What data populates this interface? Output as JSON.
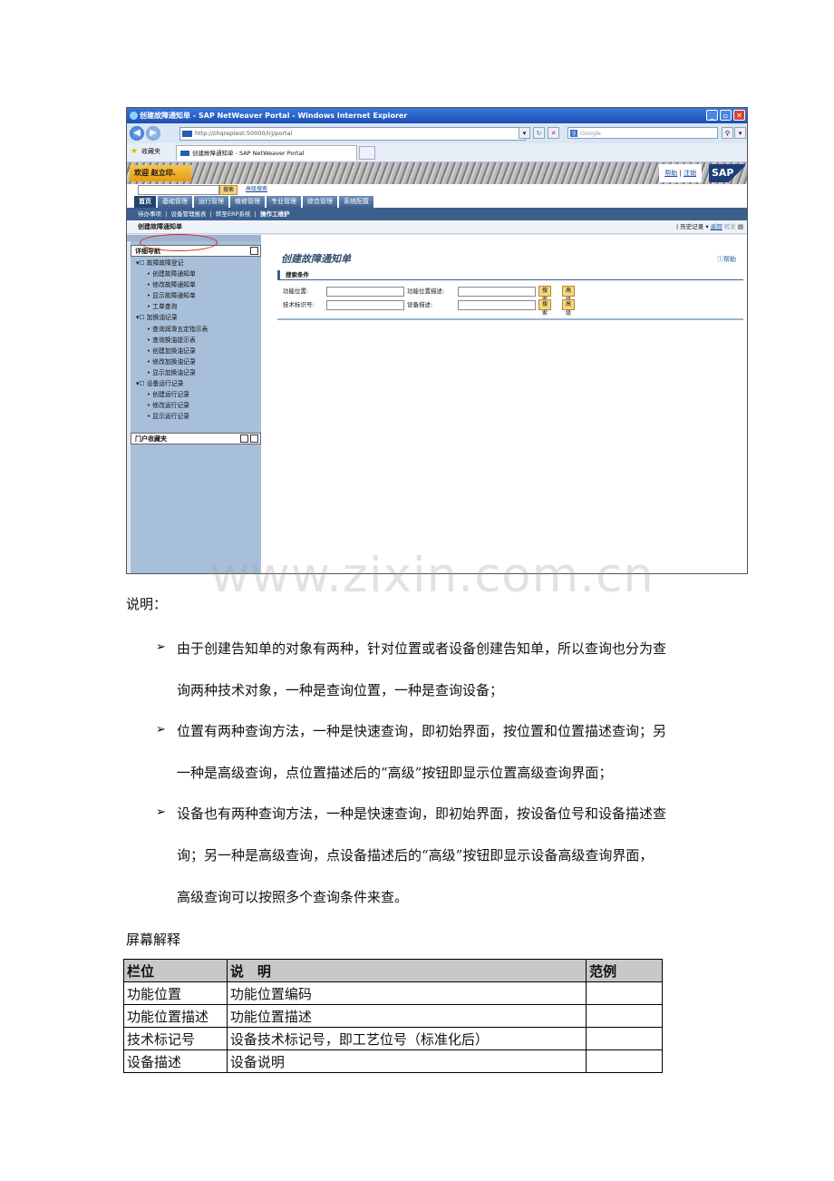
{
  "browser": {
    "title": "创建故障通知单 - SAP NetWeaver Portal - Windows Internet Explorer",
    "address": "http://zhqreptest:50000/irj/portal",
    "search_placeholder": "Google",
    "favorites_label": "收藏夹",
    "tab_title": "创建故障通知单 - SAP NetWeaver Portal"
  },
  "portal": {
    "welcome": "欢迎 赵立印.",
    "help_link": "帮助",
    "logout_link": "注销",
    "logo": "SAP",
    "search_button": "搜索",
    "advanced_search": "高级搜索",
    "top_tabs": [
      "首页",
      "基础管理",
      "运行管理",
      "维修管理",
      "专业管理",
      "综合管理",
      "系统配置"
    ],
    "sub_nav": [
      "待办事项",
      "设备管理报表",
      "转至ERP系统",
      "操作工维护"
    ],
    "page_header": "创建故障通知单",
    "history": "历史记录",
    "back": "返回",
    "forward": "转发",
    "detail_nav_title": "详细导航",
    "nav_groups": [
      {
        "label": "▾☐ 故障故障登记",
        "items": [
          "创建故障通知单",
          "修改故障通知单",
          "显示故障通知单",
          "工单查询"
        ]
      },
      {
        "label": "▾☐ 加换油记录",
        "items": [
          "查询润滑五定指示表",
          "查询换油提示表",
          "创建加换油记录",
          "修改加换油记录",
          "显示加换油记录"
        ]
      },
      {
        "label": "▾☐ 设备运行记录",
        "items": [
          "创建运行记录",
          "修改运行记录",
          "显示运行记录"
        ]
      }
    ],
    "favorites_title": "门户收藏夹",
    "form_title": "创建故障通知单",
    "form_help": "帮助",
    "search_criteria": "搜索条件",
    "fields": {
      "func_loc": "功能位置:",
      "func_loc_desc": "功能位置描述:",
      "tech_id": "技术标识号:",
      "equip_desc": "设备描述:",
      "search_btn": "搜索",
      "advanced_btn": "高级"
    }
  },
  "watermark": "www.zixin.com.cn",
  "doc": {
    "note_label": "说明：",
    "bullets": [
      [
        "由于创建告知单的对象有两种，针对位置或者设备创建告知单，所以查询也分为查",
        "询两种技术对象，一种是查询位置，一种是查询设备；"
      ],
      [
        "位置有两种查询方法，一种是快速查询，即初始界面，按位置和位置描述查询；另",
        "一种是高级查询，点位置描述后的“高级”按钮即显示位置高级查询界面；"
      ],
      [
        "设备也有两种查询方法，一种是快速查询，即初始界面，按设备位号和设备描述查",
        "询；另一种是高级查询，点设备描述后的“高级”按钮即显示设备高级查询界面，",
        "高级查询可以按照多个查询条件来查。"
      ]
    ],
    "screen_title": "屏幕解释",
    "table": {
      "headers": [
        "栏位",
        "说　明",
        "范例"
      ],
      "rows": [
        [
          "功能位置",
          "功能位置编码",
          ""
        ],
        [
          "功能位置描述",
          "功能位置描述",
          ""
        ],
        [
          "技术标记号",
          "设备技术标记号，即工艺位号（标准化后）",
          ""
        ],
        [
          "设备描述",
          "设备说明",
          ""
        ]
      ]
    }
  }
}
